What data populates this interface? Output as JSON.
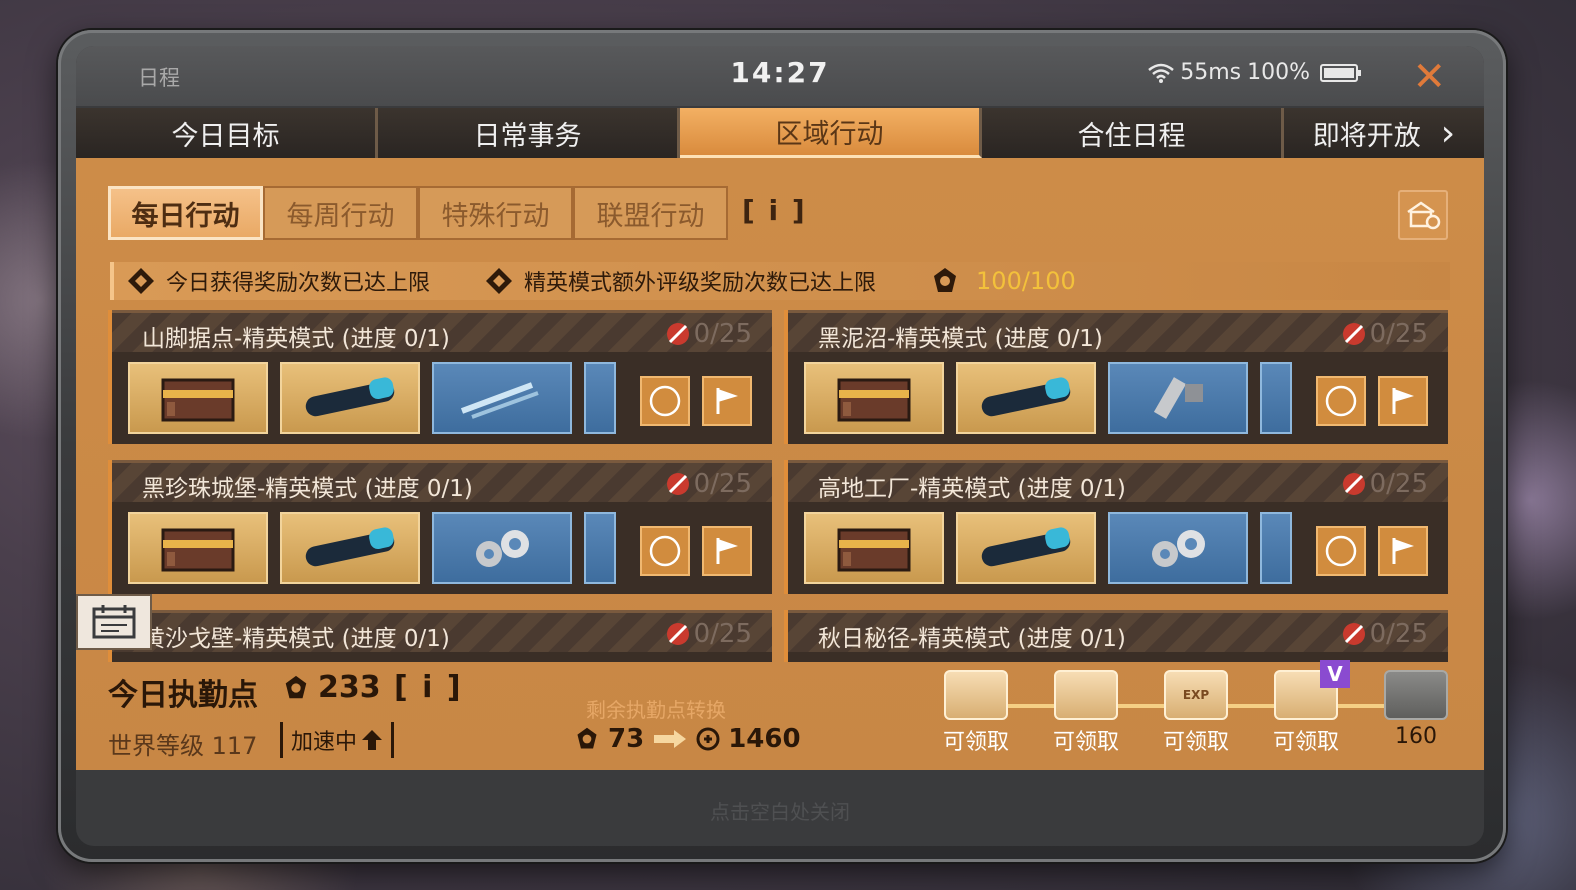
{
  "status_bar": {
    "title": "日程",
    "time": "14:27",
    "ping": "55ms",
    "battery": "100%"
  },
  "main_tabs": [
    {
      "label": "今日目标"
    },
    {
      "label": "日常事务"
    },
    {
      "label": "区域行动",
      "active": true
    },
    {
      "label": "合住日程"
    },
    {
      "label": "即将开放"
    }
  ],
  "sub_tabs": [
    {
      "label": "每日行动",
      "active": true
    },
    {
      "label": "每周行动"
    },
    {
      "label": "特殊行动"
    },
    {
      "label": "联盟行动"
    }
  ],
  "info_label": "[ i ]",
  "notice": {
    "item1": "今日获得奖励次数已达上限",
    "item2": "精英模式额外评级奖励次数已达上限",
    "count": "100/100"
  },
  "missions": [
    {
      "title": "山脚据点-精英模式",
      "progress": "(进度 0/1)",
      "limit": "0/25",
      "third_reward": "tools"
    },
    {
      "title": "黑泥沼-精英模式",
      "progress": "(进度 0/1)",
      "limit": "0/25",
      "third_reward": "bolts"
    },
    {
      "title": "黑珍珠城堡-精英模式",
      "progress": "(进度 0/1)",
      "limit": "0/25",
      "third_reward": "bearings"
    },
    {
      "title": "高地工厂-精英模式",
      "progress": "(进度 0/1)",
      "limit": "0/25",
      "third_reward": "bearings"
    },
    {
      "title": "黄沙戈壁-精英模式",
      "progress": "(进度 0/1)",
      "limit": "0/25"
    },
    {
      "title": "秋日秘径-精英模式",
      "progress": "(进度 0/1)",
      "limit": "0/25"
    }
  ],
  "summary": {
    "duty_label": "今日执勤点",
    "duty_value": "233",
    "world_level": "世界等级 117",
    "speedup": "加速中",
    "convert_title": "剩余执勤点转换",
    "convert_from": "73",
    "convert_to": "1460"
  },
  "chests": [
    {
      "label": "可领取",
      "tag": ""
    },
    {
      "label": "可领取",
      "tag": ""
    },
    {
      "label": "可领取",
      "tag": "EXP"
    },
    {
      "label": "可领取",
      "tag": "",
      "vip": "V"
    },
    {
      "label": "160",
      "locked": true
    }
  ],
  "close_hint": "点击空白处关闭",
  "colors": {
    "accent_orange": "#e08e3a",
    "panel": "#cd8c48",
    "count_yellow": "#f3c13b",
    "close_x": "#e07a3a"
  }
}
